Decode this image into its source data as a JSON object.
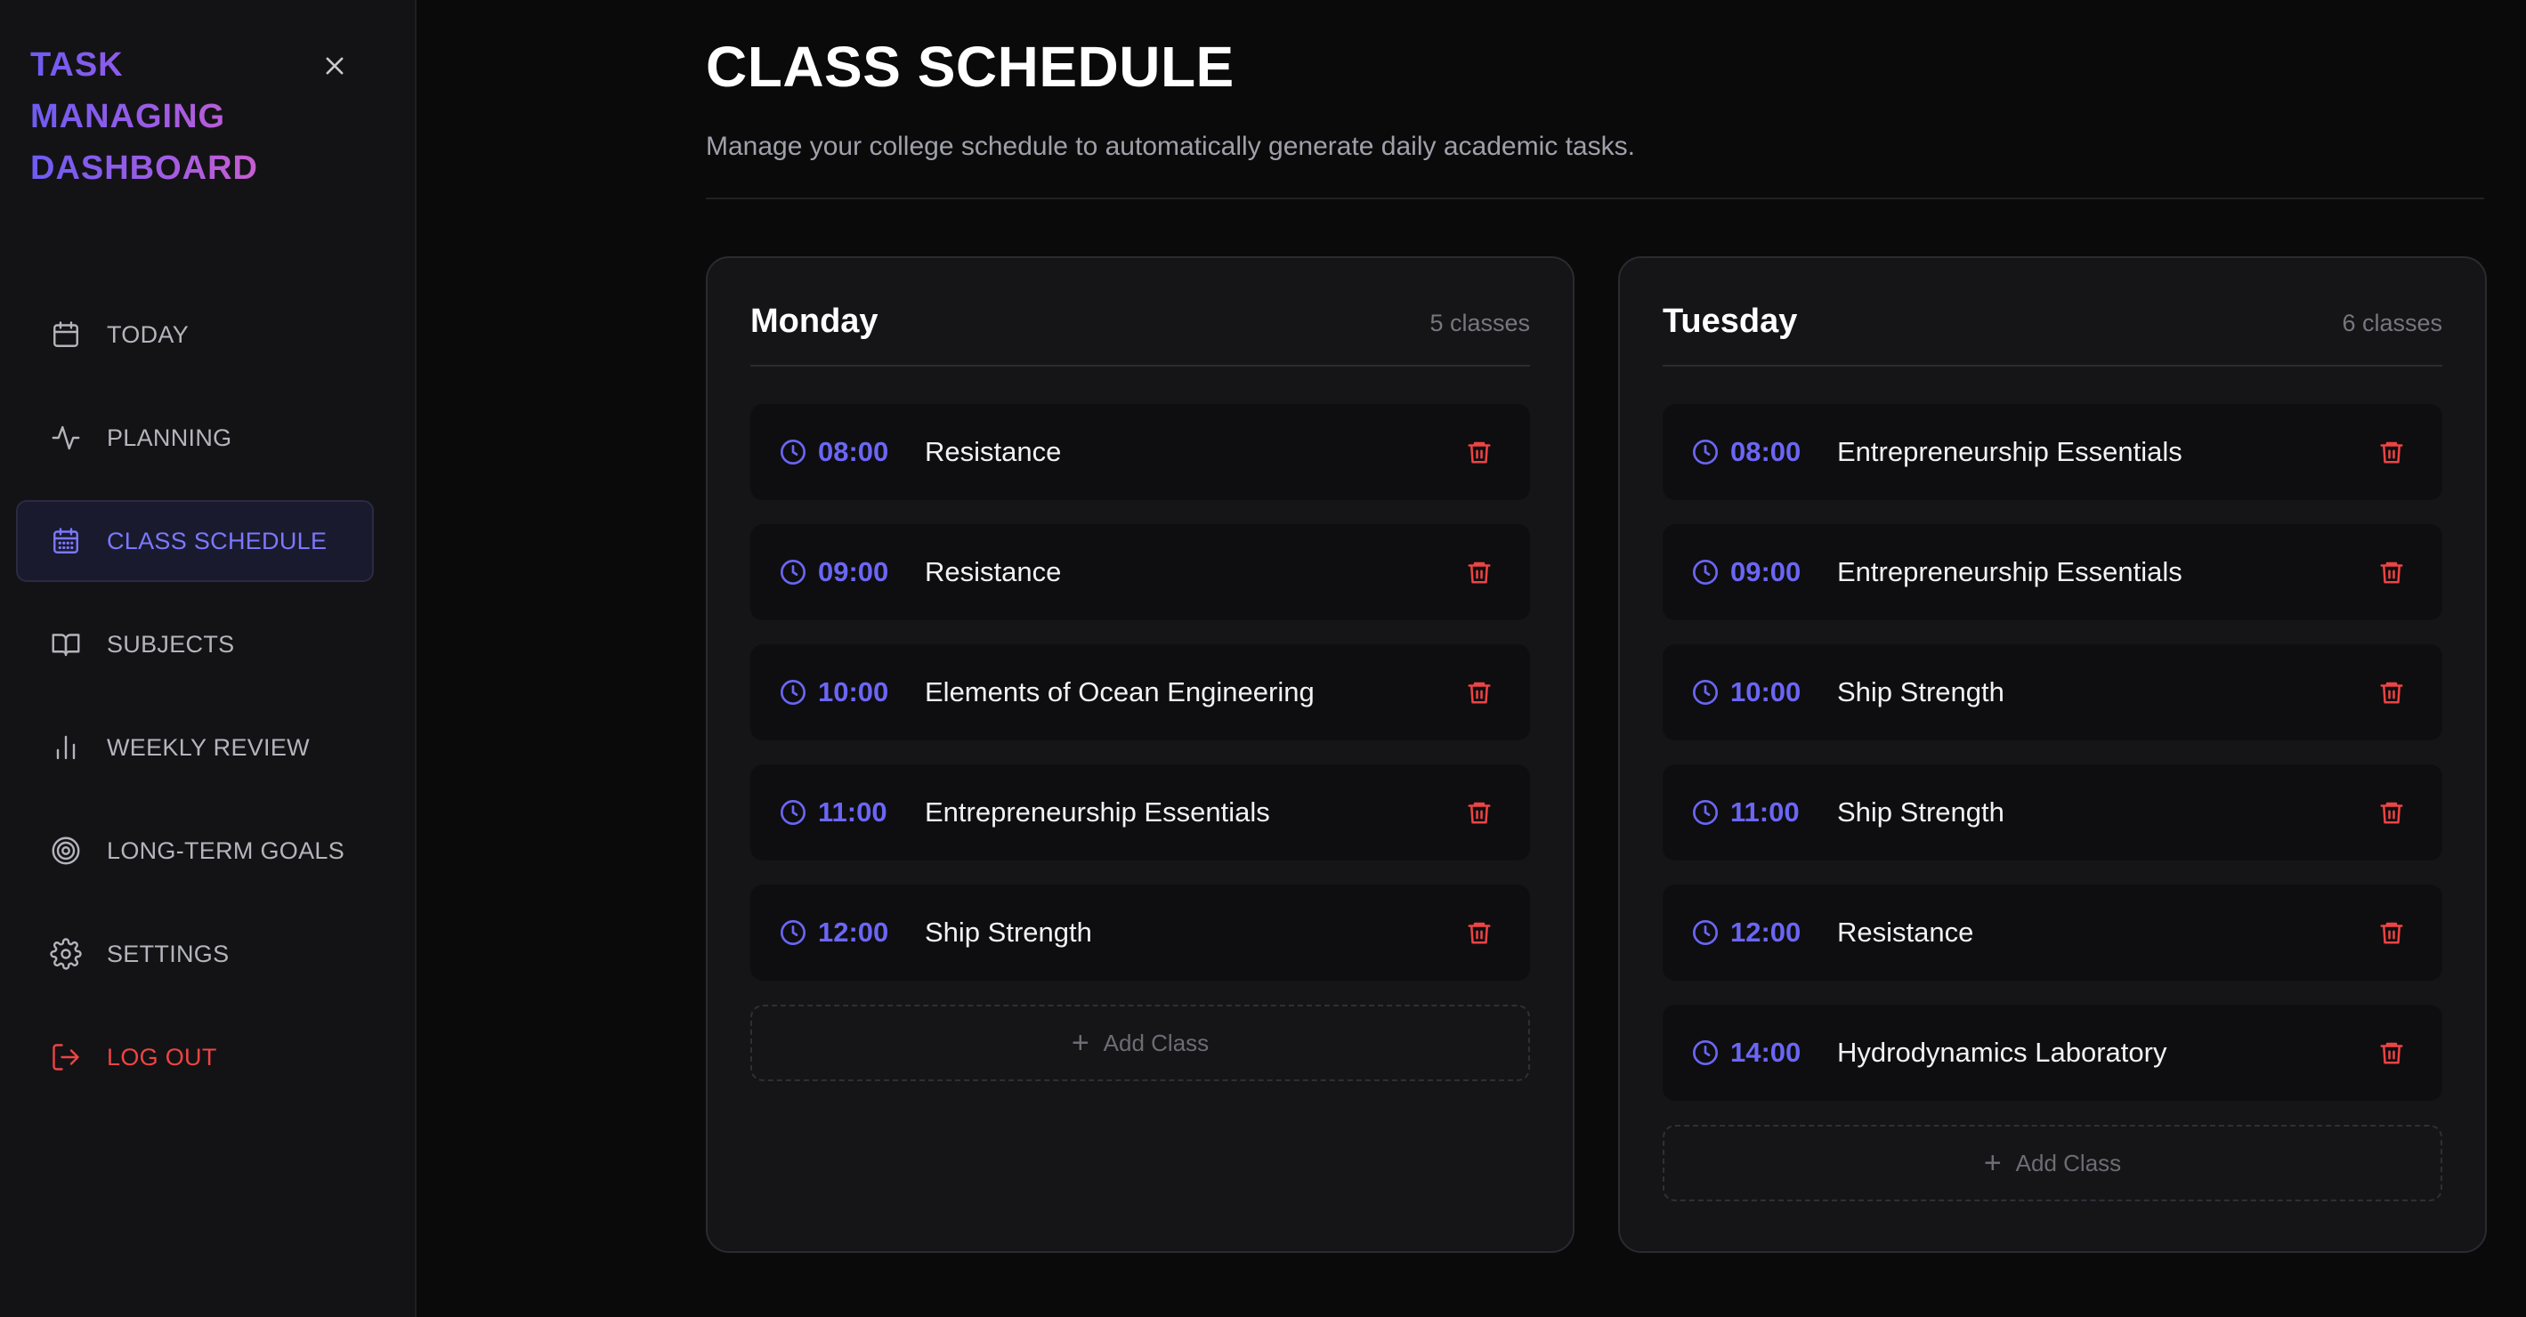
{
  "brand": {
    "line1": "TASK",
    "line2": "MANAGING",
    "line3": "DASHBOARD"
  },
  "sidebar": {
    "items": [
      {
        "label": "TODAY",
        "icon": "calendar-icon",
        "active": false
      },
      {
        "label": "PLANNING",
        "icon": "activity-icon",
        "active": false
      },
      {
        "label": "CLASS SCHEDULE",
        "icon": "calendar-grid-icon",
        "active": true
      },
      {
        "label": "SUBJECTS",
        "icon": "book-icon",
        "active": false
      },
      {
        "label": "WEEKLY REVIEW",
        "icon": "bar-chart-icon",
        "active": false
      },
      {
        "label": "LONG-TERM GOALS",
        "icon": "target-icon",
        "active": false
      },
      {
        "label": "SETTINGS",
        "icon": "gear-icon",
        "active": false
      }
    ],
    "logout": {
      "label": "LOG OUT",
      "icon": "logout-icon"
    }
  },
  "main": {
    "title": "CLASS SCHEDULE",
    "subtitle": "Manage your college schedule to automatically generate daily academic tasks."
  },
  "days": [
    {
      "name": "Monday",
      "count": "5 classes",
      "classes": [
        {
          "time": "08:00",
          "name": "Resistance"
        },
        {
          "time": "09:00",
          "name": "Resistance"
        },
        {
          "time": "10:00",
          "name": "Elements of Ocean Engineering"
        },
        {
          "time": "11:00",
          "name": "Entrepreneurship Essentials"
        },
        {
          "time": "12:00",
          "name": "Ship Strength"
        }
      ],
      "add_label": "Add Class"
    },
    {
      "name": "Tuesday",
      "count": "6 classes",
      "classes": [
        {
          "time": "08:00",
          "name": "Entrepreneurship Essentials"
        },
        {
          "time": "09:00",
          "name": "Entrepreneurship Essentials"
        },
        {
          "time": "10:00",
          "name": "Ship Strength"
        },
        {
          "time": "11:00",
          "name": "Ship Strength"
        },
        {
          "time": "12:00",
          "name": "Resistance"
        },
        {
          "time": "14:00",
          "name": "Hydrodynamics Laboratory"
        }
      ],
      "add_label": "Add Class"
    }
  ],
  "colors": {
    "accent": "#6b66f5",
    "danger": "#ef4444",
    "background": "#0a0a0b",
    "sidebar": "#131316",
    "card": "#151518"
  }
}
